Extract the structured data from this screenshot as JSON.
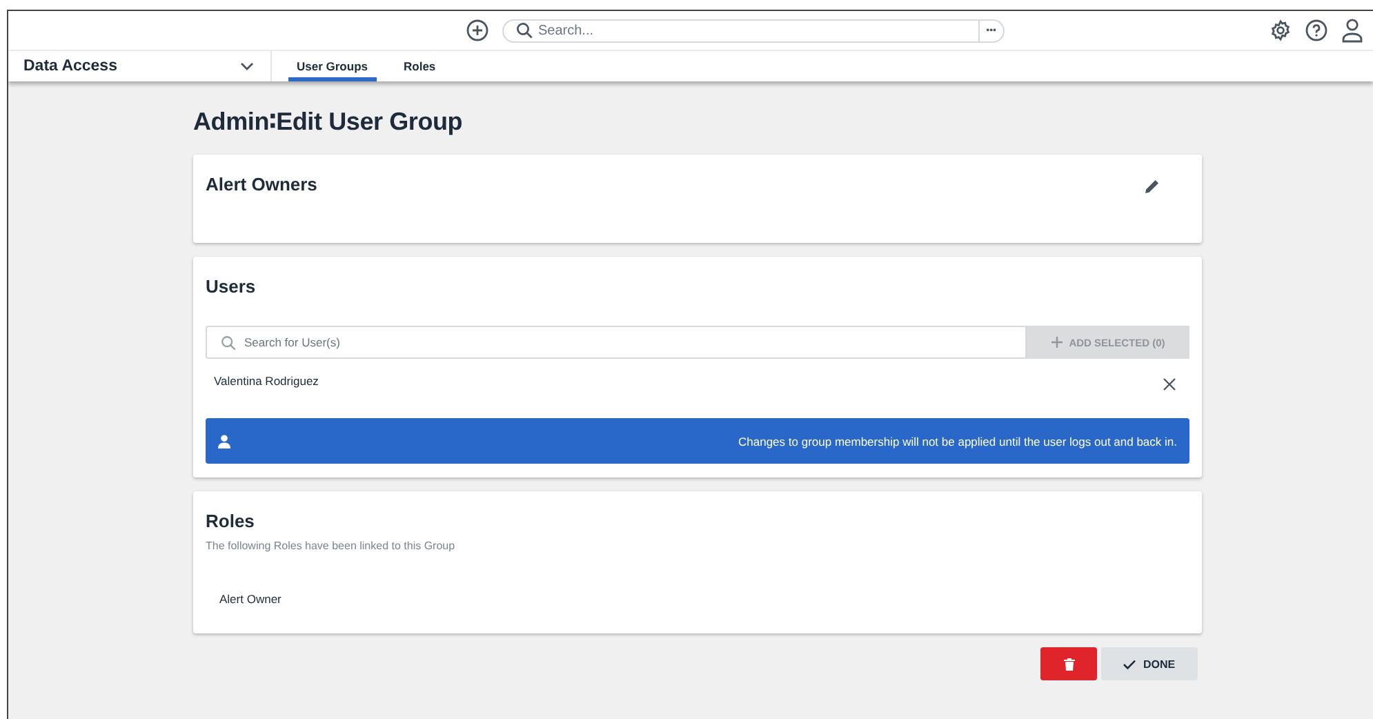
{
  "top_bar": {
    "search": {
      "placeholder": "Search..."
    },
    "more": "•••"
  },
  "nav": {
    "app": "Data Access",
    "tabs": [
      {
        "label": "User Groups",
        "selected": true
      },
      {
        "label": "Roles",
        "selected": false
      }
    ]
  },
  "page_title": "Admin∶Edit User Group",
  "group_card": {
    "name": "Alert Owners"
  },
  "users_card": {
    "title": "Users",
    "search": {
      "placeholder": "Search for User(s)"
    },
    "add_button": {
      "label": "ADD SELECTED (0)",
      "disabled": true
    },
    "users": [
      {
        "name": "Valentina Rodriguez"
      }
    ],
    "notice": "Changes to group membership will not be applied until the user logs out and back in."
  },
  "roles_card": {
    "title": "Roles",
    "subtitle": "The following Roles have been linked to this Group",
    "roles": [
      {
        "name": "Alert Owner"
      }
    ]
  },
  "actions": {
    "done": "DONE"
  }
}
